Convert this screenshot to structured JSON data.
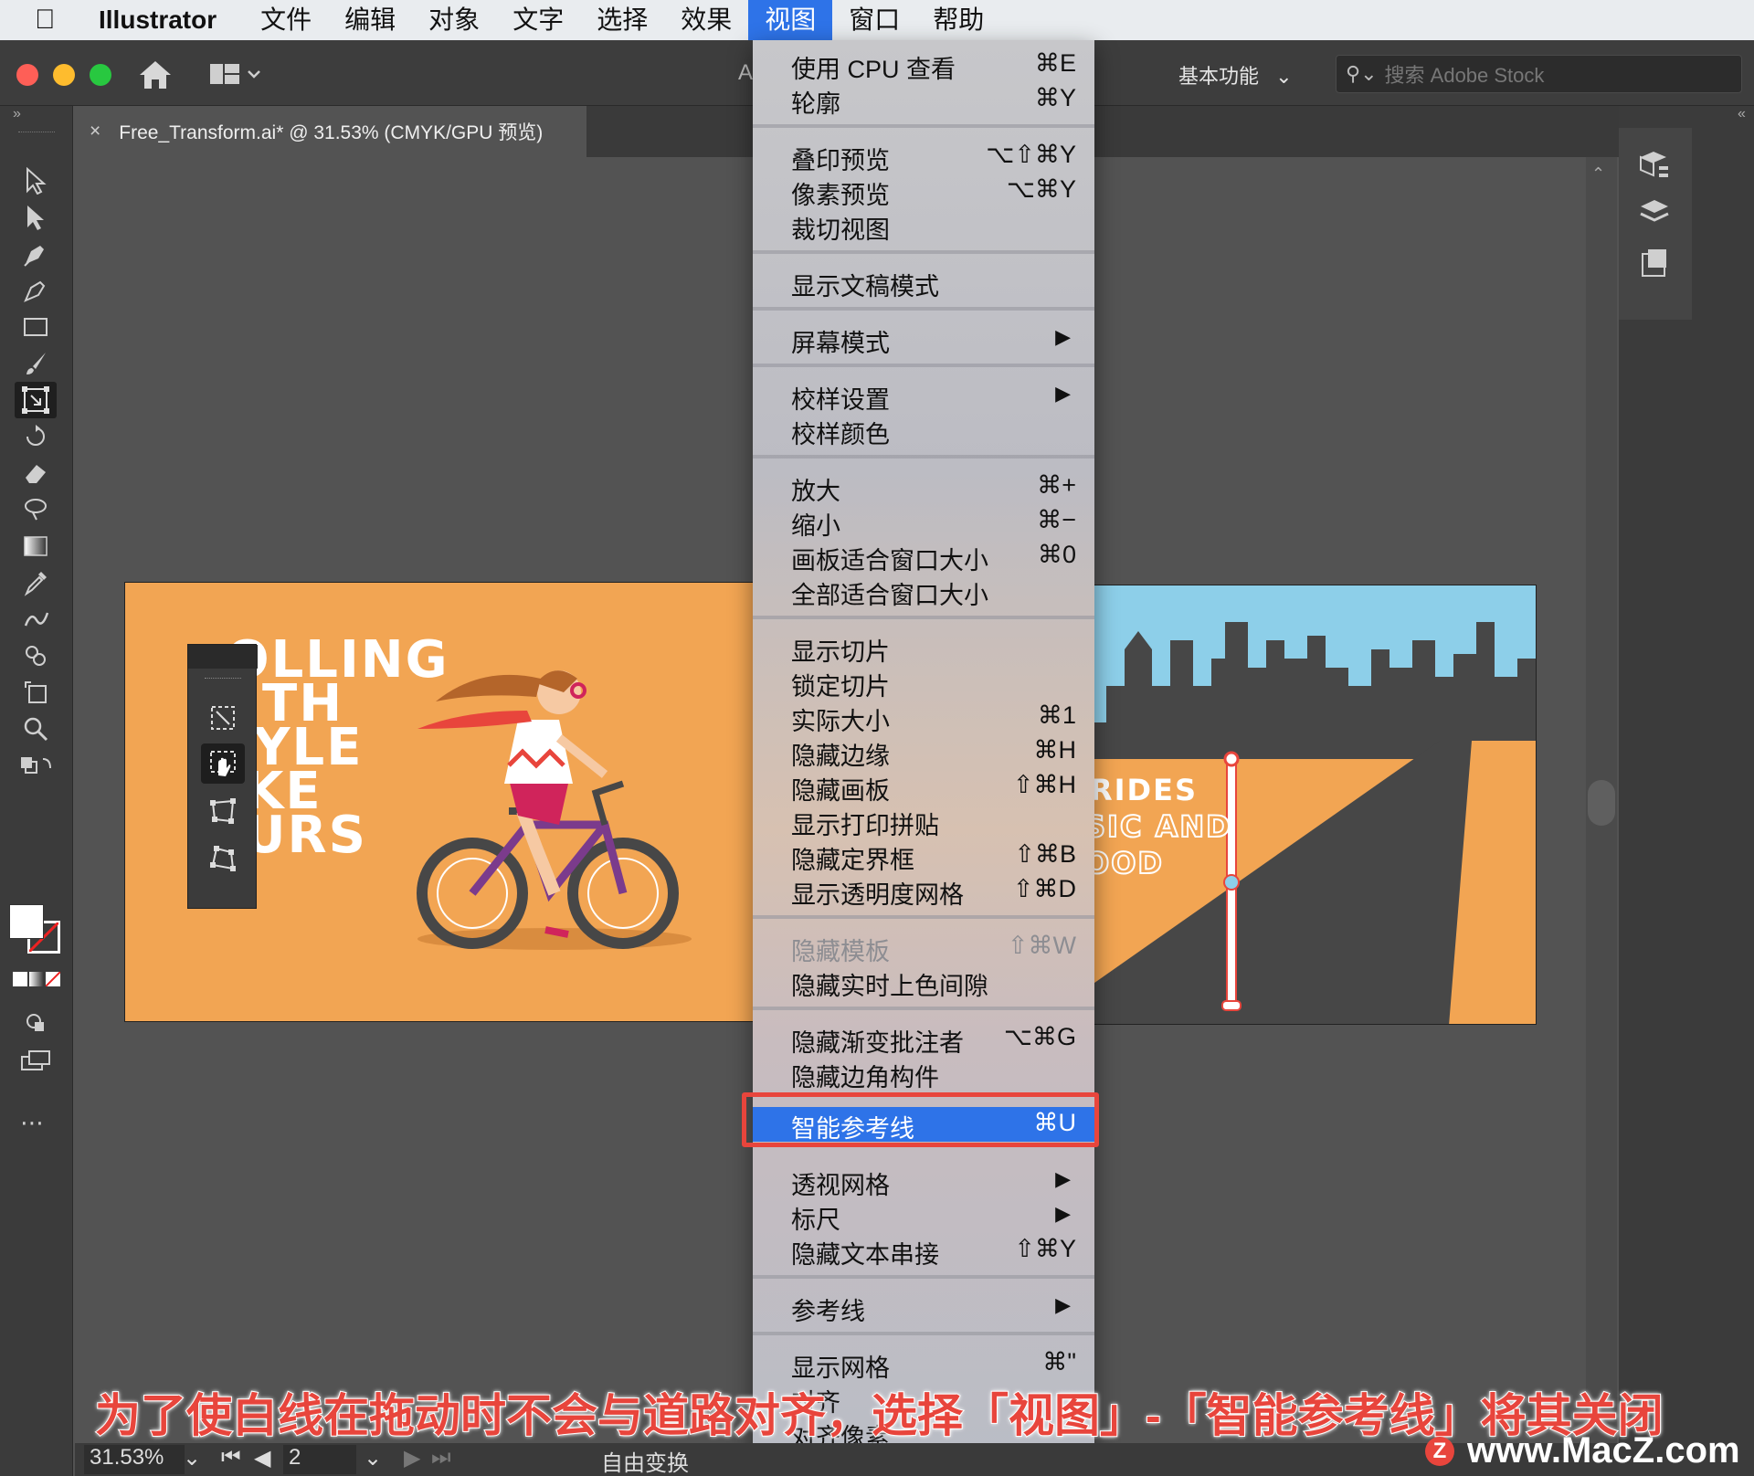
{
  "menubar": {
    "app_name": "Illustrator",
    "items": [
      "文件",
      "编辑",
      "对象",
      "文字",
      "选择",
      "效果",
      "视图",
      "窗口",
      "帮助"
    ],
    "active_item": "视图"
  },
  "appbar": {
    "partial_title": "A",
    "workspace": "基本功能",
    "search_placeholder": "搜索 Adobe Stock"
  },
  "document_tab": {
    "close": "×",
    "title": "Free_Transform.ai* @ 31.53% (CMYK/GPU 预览)"
  },
  "artboard_left": {
    "lines": [
      "OLLING",
      "TH",
      "YLE",
      "KE",
      "URS"
    ]
  },
  "artboard_right": {
    "lines": [
      "RIDES",
      "SIC AND",
      "OOD"
    ]
  },
  "view_menu": {
    "groups": [
      [
        {
          "label": "使用 CPU 查看",
          "shortcut": "⌘E"
        },
        {
          "label": "轮廓",
          "shortcut": "⌘Y"
        }
      ],
      [
        {
          "label": "叠印预览",
          "shortcut": "⌥⇧⌘Y"
        },
        {
          "label": "像素预览",
          "shortcut": "⌥⌘Y"
        },
        {
          "label": "裁切视图",
          "shortcut": ""
        }
      ],
      [
        {
          "label": "显示文稿模式",
          "shortcut": ""
        }
      ],
      [
        {
          "label": "屏幕模式",
          "shortcut": "",
          "submenu": true
        }
      ],
      [
        {
          "label": "校样设置",
          "shortcut": "",
          "submenu": true
        },
        {
          "label": "校样颜色",
          "shortcut": ""
        }
      ],
      [
        {
          "label": "放大",
          "shortcut": "⌘+"
        },
        {
          "label": "缩小",
          "shortcut": "⌘−"
        },
        {
          "label": "画板适合窗口大小",
          "shortcut": "⌘0"
        },
        {
          "label": "全部适合窗口大小",
          "shortcut": ""
        }
      ],
      [
        {
          "label": "显示切片",
          "shortcut": ""
        },
        {
          "label": "锁定切片",
          "shortcut": ""
        },
        {
          "label": "实际大小",
          "shortcut": "⌘1"
        },
        {
          "label": "隐藏边缘",
          "shortcut": "⌘H"
        },
        {
          "label": "隐藏画板",
          "shortcut": "⇧⌘H"
        },
        {
          "label": "显示打印拼贴",
          "shortcut": ""
        },
        {
          "label": "隐藏定界框",
          "shortcut": "⇧⌘B"
        },
        {
          "label": "显示透明度网格",
          "shortcut": "⇧⌘D"
        }
      ],
      [
        {
          "label": "隐藏模板",
          "shortcut": "⇧⌘W",
          "disabled": true
        },
        {
          "label": "隐藏实时上色间隙",
          "shortcut": ""
        }
      ],
      [
        {
          "label": "隐藏渐变批注者",
          "shortcut": "⌥⌘G"
        },
        {
          "label": "隐藏边角构件",
          "shortcut": ""
        }
      ],
      [
        {
          "label": "智能参考线",
          "shortcut": "⌘U",
          "highlighted": true
        }
      ],
      [
        {
          "label": "透视网格",
          "shortcut": "",
          "submenu": true
        },
        {
          "label": "标尺",
          "shortcut": "",
          "submenu": true
        },
        {
          "label": "隐藏文本串接",
          "shortcut": "⇧⌘Y"
        }
      ],
      [
        {
          "label": "参考线",
          "shortcut": "",
          "submenu": true
        }
      ],
      [
        {
          "label": "显示网格",
          "shortcut": "⌘\""
        },
        {
          "label": "对齐",
          "shortcut": ""
        },
        {
          "label": "对齐像素",
          "shortcut": ""
        }
      ]
    ],
    "more_arrow": "▼"
  },
  "statusbar": {
    "zoom": "31.53%",
    "artboard_number": "2",
    "tool_name": "自由变换"
  },
  "caption": "为了使白线在拖动时不会与道路对齐，选择「视图」-「智能参考线」将其关闭",
  "watermark": "www.MacZ.com",
  "watermark_badge": "Z",
  "colors": {
    "highlight": "#2e73e8",
    "annotation_red": "#e8453c",
    "artboard_orange": "#f2a553",
    "sky_blue": "#8dcfe9",
    "asphalt": "#474747"
  }
}
